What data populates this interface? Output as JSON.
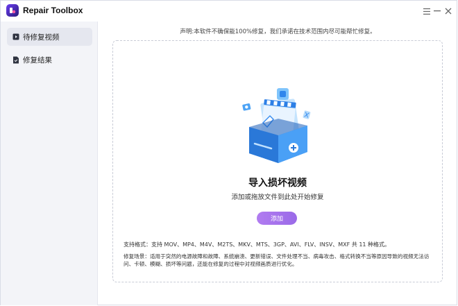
{
  "app": {
    "title": "Repair Toolbox"
  },
  "window_controls": {
    "menu_icon": "menu-icon",
    "minimize_icon": "minimize-icon",
    "close_icon": "close-icon"
  },
  "sidebar": {
    "items": [
      {
        "label": "待修复视频",
        "icon": "video-icon",
        "active": true
      },
      {
        "label": "修复结果",
        "icon": "document-icon",
        "active": false
      }
    ]
  },
  "main": {
    "notice": "声明:本软件不确保能100%修复，我们承诺在技术范围内尽可能帮忙修复。",
    "title": "导入损坏视频",
    "subtitle": "添加或拖放文件到此处开始修复",
    "add_button": "添加",
    "formats": "支持格式：支持 MOV、MP4、M4V、M2TS、MKV、MTS、3GP、AVI、FLV、INSV、MXF 共 11 种格式。",
    "scenes": "修复场景：适用于突然的电源故障和故障、系统崩溃、更新错误、文件处理不当、病毒攻击、格式转换不当等原因导致的视频无法访问、卡顿、模糊、损坏等问题，还能在修复的过程中对视频画质进行优化。"
  },
  "colors": {
    "accent": "#a575ee",
    "sidebar_bg": "#f3f4f8",
    "illustration_blue": "#3a8ef0"
  }
}
